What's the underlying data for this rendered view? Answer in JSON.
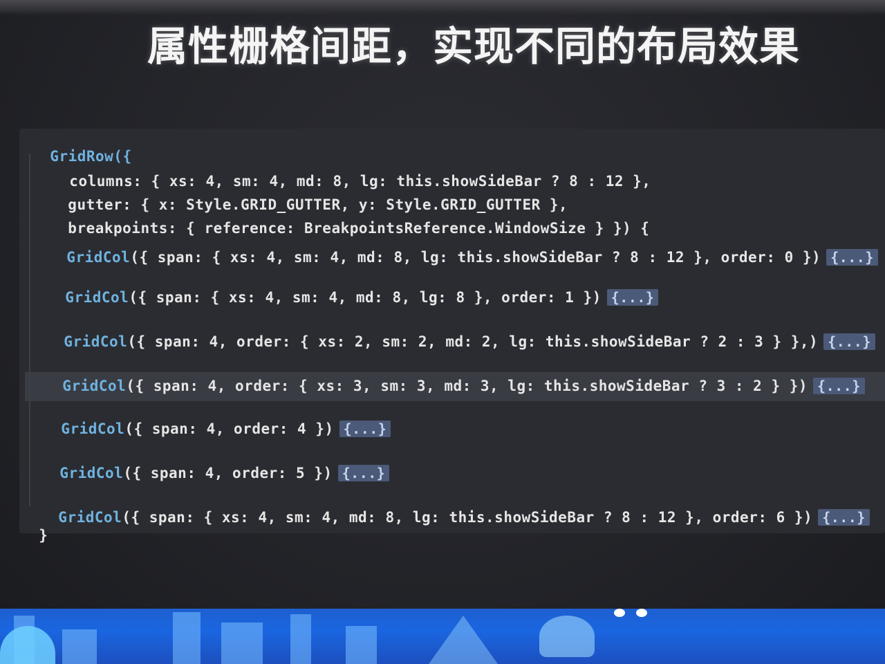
{
  "slide": {
    "title": "属性栅格间距，实现不同的布局效果"
  },
  "code": {
    "open": "GridRow({",
    "props": [
      "columns: { xs: 4, sm: 4, md: 8, lg: this.showSideBar ? 8 : 12 },",
      "gutter: { x: Style.GRID_GUTTER, y: Style.GRID_GUTTER },",
      "breakpoints: { reference: BreakpointsReference.WindowSize } }) {"
    ],
    "cols": [
      {
        "name": "GridCol",
        "args": "({ span: { xs: 4, sm: 4, md: 8, lg: this.showSideBar ? 8 : 12 }, order: 0 })",
        "fold": "{...}"
      },
      {
        "name": "GridCol",
        "args": "({ span: { xs: 4, sm: 4, md: 8, lg: 8 }, order: 1 })",
        "fold": "{...}"
      },
      {
        "name": "GridCol",
        "args": "({ span: 4, order: { xs: 2, sm: 2, md: 2, lg: this.showSideBar ? 2 : 3 } },)",
        "fold": "{...}"
      },
      {
        "name": "GridCol",
        "args": "({ span: 4, order: { xs: 3, sm: 3, md: 3, lg: this.showSideBar ? 3 : 2 } })",
        "fold": "{...}"
      },
      {
        "name": "GridCol",
        "args": "({ span: 4, order: 4 })",
        "fold": "{...}"
      },
      {
        "name": "GridCol",
        "args": "({ span: 4, order: 5 })",
        "fold": "{...}"
      },
      {
        "name": "GridCol",
        "args": "({ span: { xs: 4, sm: 4, md: 8, lg: this.showSideBar ? 8 : 12 }, order: 6 })",
        "fold": "{...}"
      }
    ],
    "close": "}"
  }
}
